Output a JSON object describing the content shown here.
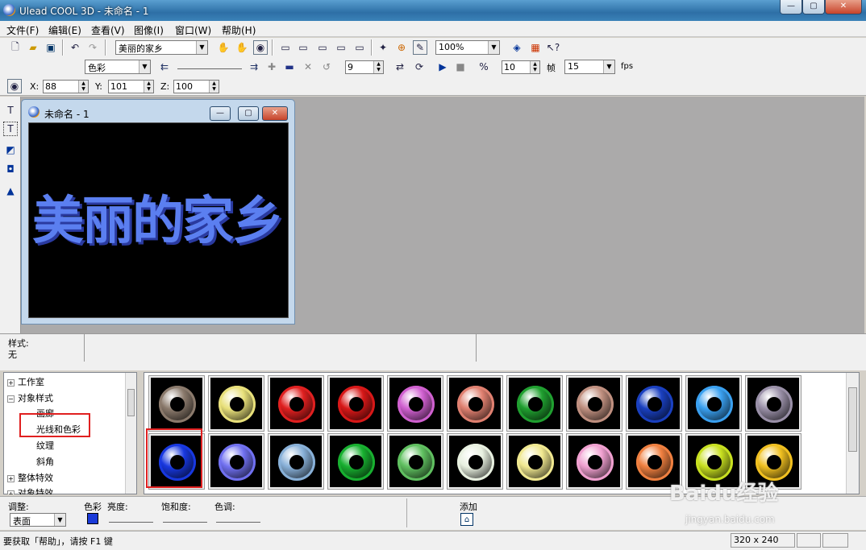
{
  "window": {
    "title": "Ulead COOL 3D - 未命名 - 1",
    "min": "—",
    "max": "▢",
    "close": "✕"
  },
  "menu": [
    "文件(F)",
    "编辑(E)",
    "查看(V)",
    "图像(I)",
    "窗口(W)",
    "帮助(H)"
  ],
  "toolbar1": {
    "text_object": "美丽的家乡",
    "zoom": "100%"
  },
  "toolbar2": {
    "attribute": "色彩",
    "frame": "9",
    "fps_value": "10",
    "frames_label": "帧",
    "fps_rate": "15",
    "fps_label": "fps"
  },
  "toolbar3": {
    "x_label": "X:",
    "x": "88",
    "y_label": "Y:",
    "y": "101",
    "z_label": "Z:",
    "z": "100"
  },
  "document": {
    "title": "未命名 - 1",
    "canvas_text": "美丽的家乡"
  },
  "style_panel": {
    "label": "样式:",
    "value": "无"
  },
  "tree": {
    "items": [
      {
        "label": "工作室",
        "expander": "+"
      },
      {
        "label": "对象样式",
        "expander": "−"
      },
      {
        "label": "画廊",
        "expander": ""
      },
      {
        "label": "光线和色彩",
        "expander": ""
      },
      {
        "label": "纹理",
        "expander": ""
      },
      {
        "label": "斜角",
        "expander": ""
      },
      {
        "label": "整体特效",
        "expander": "+"
      },
      {
        "label": "对象特效",
        "expander": "+"
      }
    ]
  },
  "gallery": {
    "row1": [
      "#8b7a6c",
      "#e8e07a",
      "#e02020",
      "#d81818",
      "#d060d0",
      "#e08070",
      "#20a030",
      "#c09080",
      "#1a40c0",
      "#3aa0f0",
      "#9a90a8"
    ],
    "row2": [
      "#1838e0",
      "#7070f0",
      "#88b0d8",
      "#18b030",
      "#60c060",
      "#e8f0e0",
      "#f0e890",
      "#f0a0d0",
      "#f08040",
      "#c8e020",
      "#f0c020"
    ]
  },
  "bottom": {
    "adjust_label": "调整:",
    "adjust_value": "表面",
    "color_label": "色彩",
    "brightness_label": "亮度:",
    "saturation_label": "饱和度:",
    "hue_label": "色调:",
    "add_label": "添加",
    "color_swatch": "#1a3ad8"
  },
  "status": {
    "help_text": "要获取「帮助」，请按 F1 键",
    "size": "320 x 240"
  },
  "watermark": {
    "text": "Baidu经验",
    "url": "jingyan.baidu.com"
  }
}
